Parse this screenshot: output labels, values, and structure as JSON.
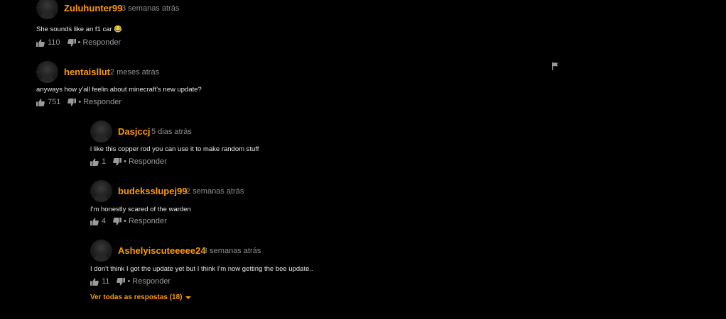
{
  "comments": [
    {
      "username": "Zuluhunter99",
      "time": "3 semanas atrás",
      "text": "She sounds like an f1 car 😂",
      "likes": "110",
      "reply_label": "Responder"
    },
    {
      "username": "hentaisllut",
      "time": "2 meses atrás",
      "text": "anyways how y'all feelin about minecraft's new update?",
      "likes": "751",
      "reply_label": "Responder"
    },
    {
      "username": "Dasjccj",
      "time": "5 dias atrás",
      "text": "i like this copper rod you can use it to make random stuff",
      "likes": "1",
      "reply_label": "Responder"
    },
    {
      "username": "budeksslupej99",
      "time": "2 semanas atrás",
      "text": "I'm honestly scared of the warden",
      "likes": "4",
      "reply_label": "Responder"
    },
    {
      "username": "Ashelyiscuteeeee24",
      "time": "3 semanas atrás",
      "text": "I don't think I got the update yet but I think I'm now getting the bee update..",
      "likes": "11",
      "reply_label": "Responder"
    }
  ],
  "separator": "•",
  "view_replies_label": "Ver todas as respostas (18)",
  "icons": {
    "like": "thumbs-up-icon",
    "dislike": "thumbs-down-icon",
    "flag": "flag-icon",
    "expand": "chevron-down-icon"
  },
  "colors": {
    "background": "#000000",
    "username": "#ff9900",
    "meta": "#8f8f8f",
    "text": "#e8e8e8"
  }
}
